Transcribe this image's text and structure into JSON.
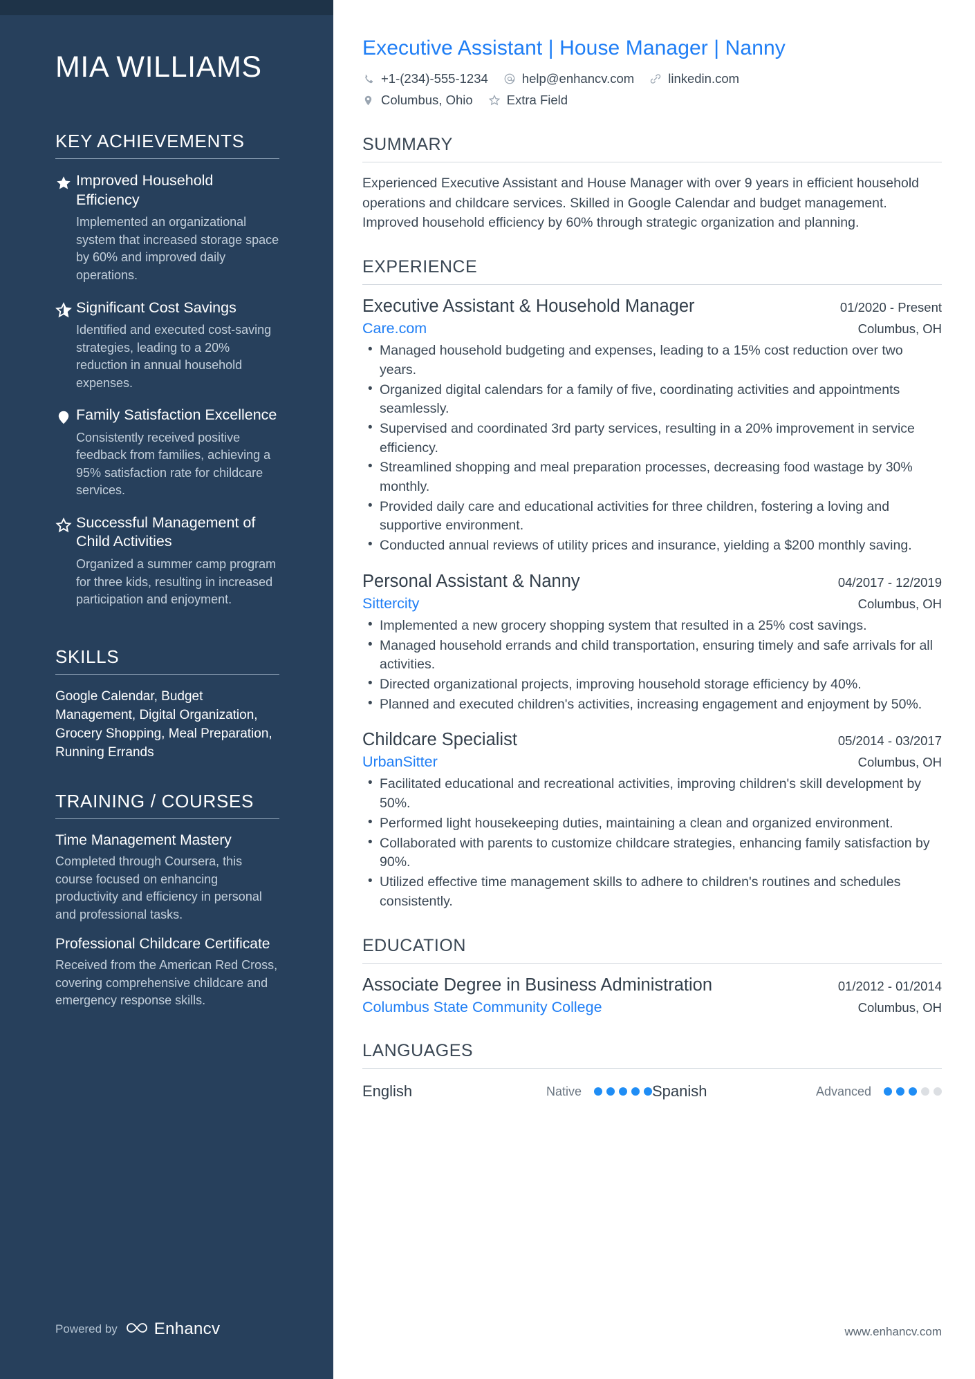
{
  "colors": {
    "sidebar_bg": "#27405c",
    "sidebar_top_strip": "#1e3348",
    "accent_blue": "#1f7ef5",
    "dot_active": "#1f8df5",
    "dot_inactive": "#dcdfe3",
    "body_text": "#3a4754"
  },
  "sidebar": {
    "candidate_name": "MIA WILLIAMS",
    "key_achievements": {
      "title": "KEY ACHIEVEMENTS",
      "items": [
        {
          "icon": "star-filled-icon",
          "title": "Improved Household Efficiency",
          "description": "Implemented an organizational system that increased storage space by 60% and improved daily operations."
        },
        {
          "icon": "star-half-filled-icon",
          "title": "Significant Cost Savings",
          "description": "Identified and executed cost-saving strategies, leading to a 20% reduction in annual household expenses."
        },
        {
          "icon": "pin-filled-icon",
          "title": "Family Satisfaction Excellence",
          "description": "Consistently received positive feedback from families, achieving a 95% satisfaction rate for childcare services."
        },
        {
          "icon": "star-outline-icon",
          "title": "Successful Management of Child Activities",
          "description": "Organized a summer camp program for three kids, resulting in increased participation and enjoyment."
        }
      ]
    },
    "skills": {
      "title": "SKILLS",
      "text": "Google Calendar, Budget Management, Digital Organization, Grocery Shopping, Meal Preparation, Running Errands"
    },
    "training": {
      "title": "TRAINING / COURSES",
      "items": [
        {
          "title": "Time Management Mastery",
          "description": "Completed through Coursera, this course focused on enhancing productivity and efficiency in personal and professional tasks."
        },
        {
          "title": "Professional Childcare Certificate",
          "description": "Received from the American Red Cross, covering comprehensive childcare and emergency response skills."
        }
      ]
    },
    "powered_by": {
      "label": "Powered by",
      "brand": "Enhancv",
      "logo_icon": "enhancv-infinity-icon"
    }
  },
  "main": {
    "job_title": "Executive Assistant | House Manager | Nanny",
    "contacts_line1": [
      {
        "icon": "phone-icon",
        "value": "+1-(234)-555-1234"
      },
      {
        "icon": "at-email-icon",
        "value": "help@enhancv.com"
      },
      {
        "icon": "link-icon",
        "value": "linkedin.com"
      }
    ],
    "contacts_line2": [
      {
        "icon": "location-pin-icon",
        "value": "Columbus, Ohio"
      },
      {
        "icon": "star-outline-icon",
        "value": "Extra Field"
      }
    ],
    "summary": {
      "title": "SUMMARY",
      "text": "Experienced Executive Assistant and House Manager with over 9 years in efficient household operations and childcare services. Skilled in Google Calendar and budget management. Improved household efficiency by 60% through strategic organization and planning."
    },
    "experience": {
      "title": "EXPERIENCE",
      "entries": [
        {
          "role": "Executive Assistant & Household Manager",
          "date": "01/2020 - Present",
          "organization": "Care.com",
          "location": "Columbus, OH",
          "bullets": [
            "Managed household budgeting and expenses, leading to a 15% cost reduction over two years.",
            "Organized digital calendars for a family of five, coordinating activities and appointments seamlessly.",
            "Supervised and coordinated 3rd party services, resulting in a 20% improvement in service efficiency.",
            "Streamlined shopping and meal preparation processes, decreasing food wastage by 30% monthly.",
            "Provided daily care and educational activities for three children, fostering a loving and supportive environment.",
            "Conducted annual reviews of utility prices and insurance, yielding a $200 monthly saving."
          ]
        },
        {
          "role": "Personal Assistant & Nanny",
          "date": "04/2017 - 12/2019",
          "organization": "Sittercity",
          "location": "Columbus, OH",
          "bullets": [
            "Implemented a new grocery shopping system that resulted in a 25% cost savings.",
            "Managed household errands and child transportation, ensuring timely and safe arrivals for all activities.",
            "Directed organizational projects, improving household storage efficiency by 40%.",
            "Planned and executed children's activities, increasing engagement and enjoyment by 50%."
          ]
        },
        {
          "role": "Childcare Specialist",
          "date": "05/2014 - 03/2017",
          "organization": "UrbanSitter",
          "location": "Columbus, OH",
          "bullets": [
            "Facilitated educational and recreational activities, improving children's skill development by 50%.",
            "Performed light housekeeping duties, maintaining a clean and organized environment.",
            "Collaborated with parents to customize childcare strategies, enhancing family satisfaction by 90%.",
            "Utilized effective time management skills to adhere to children's routines and schedules consistently."
          ]
        }
      ]
    },
    "education": {
      "title": "EDUCATION",
      "entries": [
        {
          "degree": "Associate Degree in Business Administration",
          "date": "01/2012 - 01/2014",
          "institution": "Columbus State Community College",
          "location": "Columbus, OH"
        }
      ]
    },
    "languages": {
      "title": "LANGUAGES",
      "items": [
        {
          "name": "English",
          "level": "Native",
          "rating": 5,
          "max": 5
        },
        {
          "name": "Spanish",
          "level": "Advanced",
          "rating": 3,
          "max": 5
        }
      ]
    },
    "footer_url": "www.enhancv.com"
  }
}
